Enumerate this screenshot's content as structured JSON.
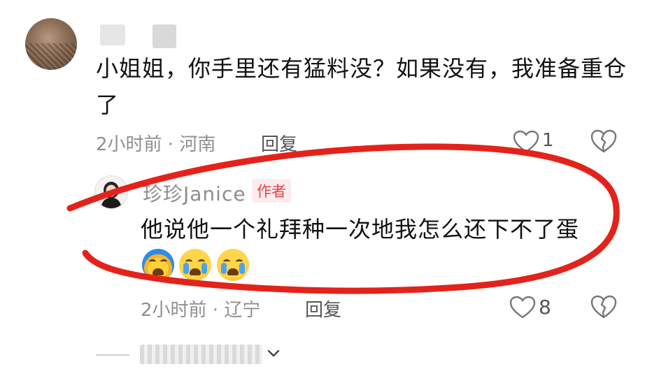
{
  "comment": {
    "text": "小姐姐，你手里还有猛料没？如果没有，我准备重仓了",
    "meta": "2小时前 · 河南",
    "reply_label": "回复",
    "like_count": "1"
  },
  "author_reply": {
    "name": "珍珍Janice",
    "badge": "作者",
    "text": "他说他一个礼拜种一次地我怎么还下不了蛋",
    "emojis": [
      "cold-sweat-emoji",
      "crying-emoji",
      "crying-emoji"
    ],
    "meta": "2小时前 · 辽宁",
    "reply_label": "回复",
    "like_count": "8"
  },
  "colors": {
    "annotation_red": "#e3231b",
    "badge_text": "#e0454f",
    "badge_bg": "#fdecec",
    "meta_gray": "#8f8f8f"
  },
  "icons": [
    "heart-icon",
    "broken-heart-icon",
    "chevron-down-icon"
  ]
}
